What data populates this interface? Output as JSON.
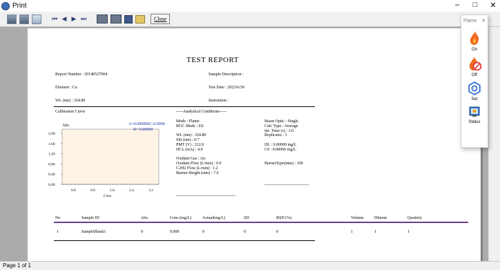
{
  "window": {
    "title": "Print",
    "controls": [
      "–",
      "□",
      "✕"
    ]
  },
  "toolbar": {
    "nav": [
      "⏮",
      "◀",
      "▶",
      "⏭"
    ],
    "close_label": "Close"
  },
  "status": {
    "page_text": "Page 1 of 1"
  },
  "flame_panel": {
    "title": "Flame",
    "close": "✕",
    "items": [
      {
        "label": "On",
        "icon": "flame-icon"
      },
      {
        "label": "Off",
        "icon": "flame-off-icon"
      },
      {
        "label": "Set",
        "icon": "gear-icon"
      },
      {
        "label": "Status",
        "icon": "status-icon"
      }
    ]
  },
  "report": {
    "title": "TEST  REPORT",
    "report_number": "Report Number : 20140527004",
    "sample_description": "Sample Description :",
    "element": "Element : Cu",
    "test_date": "Test Date : 2023/6/30",
    "wl": "WL (nm) : 324.80",
    "instrument": "Instrument :",
    "cal_curve_label": "Calibration Curve",
    "cal_equation": "A=0.000000C-0.0000",
    "cal_r": "R= 0.00000",
    "cal_ylabel": "Abs.",
    "cal_xlabel": "Conc.",
    "cal_yticks": [
      "2.00",
      "1.60",
      "1.20",
      "0.80",
      "0.40",
      "0.00"
    ],
    "cal_xticks": [
      "0.0",
      "0.8",
      "1.6",
      "2.4",
      "3.2"
    ],
    "analytical_header": "-----Analytical Conditions-----",
    "cond_col1": [
      "Mode : Flame",
      "BGC Mode : D2",
      "",
      "WL (nm) : 324.80",
      "Slit (nm) : 0.7",
      "PMT (V) : 212.0",
      "HCL (mA) : 4.0",
      "",
      "Oxidant Gas : Air",
      "Oxidant Flow (L/min) : 0.0",
      "C2H2 Flow (L/min) : 1.2",
      "Burner Height (mm) : 7.0"
    ],
    "cond_col2": [
      "Beam Optic : Single",
      "Calc Type : Average",
      "Int. Time (s) : 3.0",
      "Replicates : 3",
      "",
      "DL : 0.00000 mg/L",
      "C0 : 0.00000 mg/L",
      "",
      "",
      "BurnerType(mm) : 100"
    ],
    "dashes_short": "-------------------------------------------",
    "dashes_right": "--------------------------------",
    "table": {
      "headers": [
        "No",
        "Sample ID",
        "Abs.",
        "Conc.(mg/L)",
        "Actual(mg/L)",
        "SD",
        "RSD (%)",
        "Volume",
        "Diluent",
        "Quotiety"
      ],
      "rows": [
        [
          "1",
          "SampleBlank1",
          "0",
          "0.000",
          "0",
          "0",
          "0",
          "1",
          "1",
          "1"
        ]
      ]
    }
  },
  "colors": {
    "chart_bg": "#fdf3e6",
    "chart_text_blue": "#1a2faf",
    "table_rule": "#6a3d8c",
    "flame_orange": "#f06a1d"
  }
}
